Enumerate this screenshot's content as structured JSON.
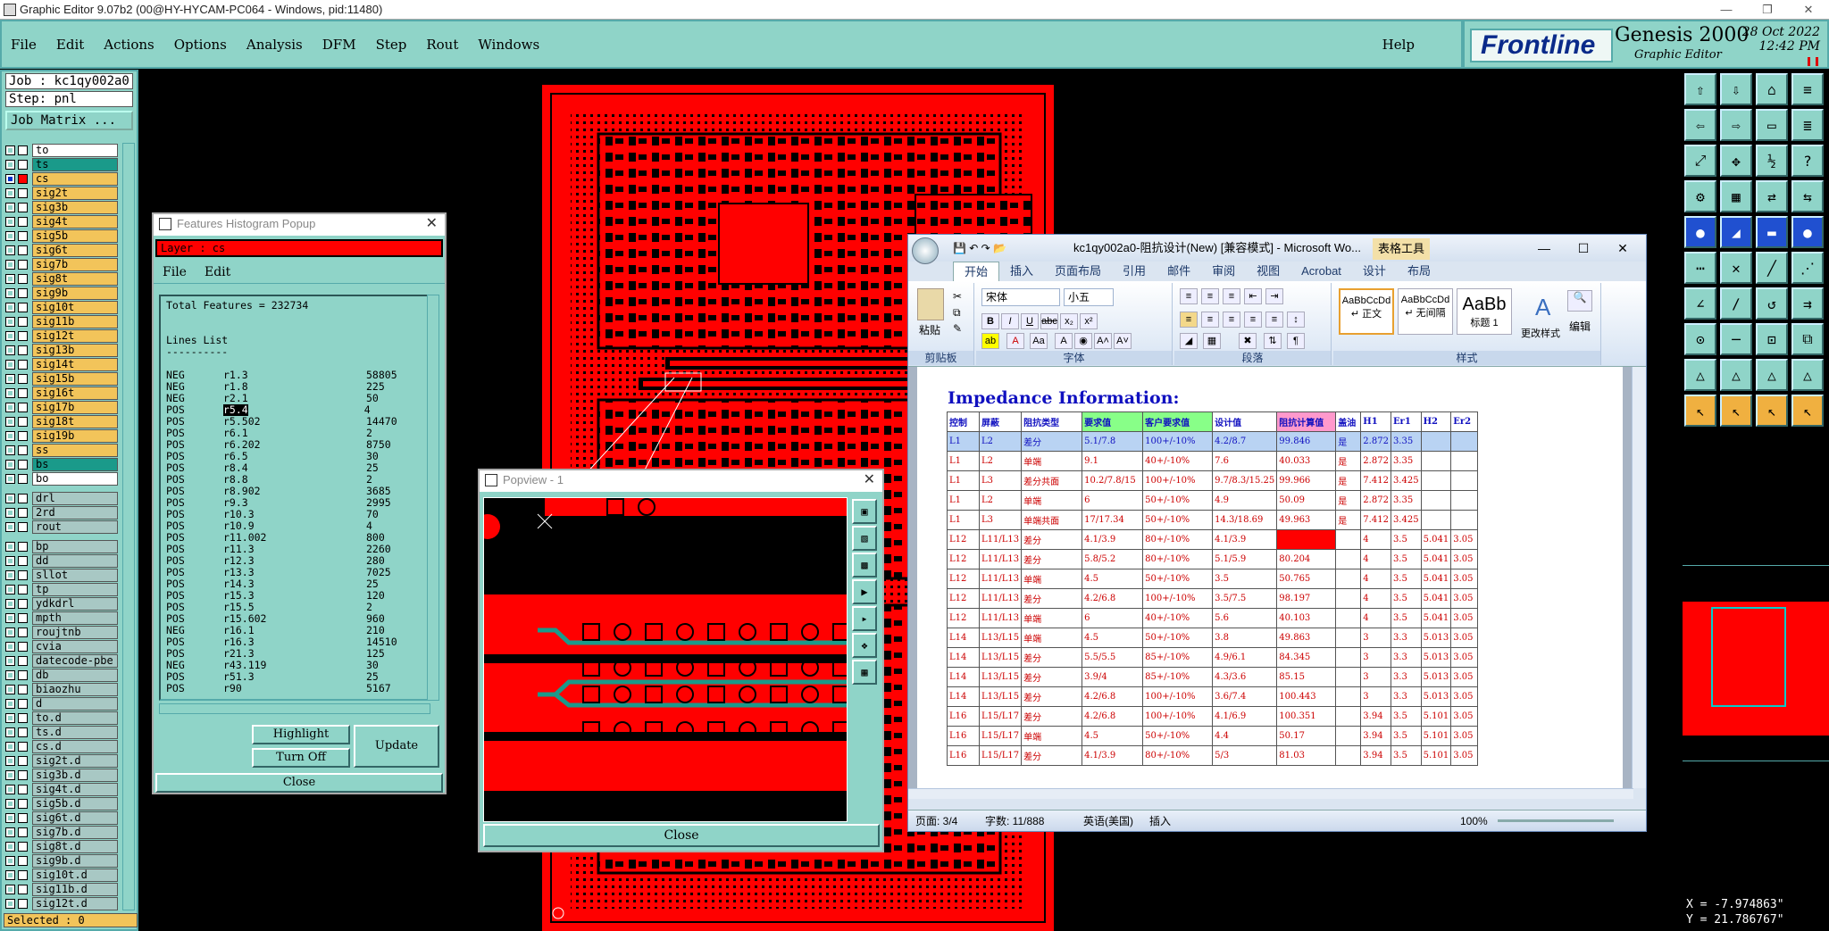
{
  "window": {
    "title": "Graphic Editor 9.07b2 (00@HY-HYCAM-PC064 - Windows, pid:11480)"
  },
  "menu": {
    "items": [
      "File",
      "Edit",
      "Actions",
      "Options",
      "Analysis",
      "DFM",
      "Step",
      "Rout",
      "Windows"
    ],
    "help": "Help"
  },
  "brand": {
    "logo": "Frontline",
    "product": "Genesis 2000",
    "editor": "Graphic Editor",
    "date": "28 Oct 2022",
    "time": "12:42 PM"
  },
  "left": {
    "job": "Job : kc1qy002a0",
    "step": "Step: pnl",
    "job_matrix": "Job Matrix ...",
    "selected": "Selected : 0",
    "layers": [
      {
        "name": "to",
        "color": "#ffffff"
      },
      {
        "name": "ts",
        "color": "#1a9a8a"
      },
      {
        "name": "cs",
        "color": "#f2c45a",
        "active": true
      },
      {
        "name": "sig2t",
        "color": "#f2c45a"
      },
      {
        "name": "sig3b",
        "color": "#f2c45a"
      },
      {
        "name": "sig4t",
        "color": "#f2c45a"
      },
      {
        "name": "sig5b",
        "color": "#f2c45a"
      },
      {
        "name": "sig6t",
        "color": "#f2c45a"
      },
      {
        "name": "sig7b",
        "color": "#f2c45a"
      },
      {
        "name": "sig8t",
        "color": "#f2c45a"
      },
      {
        "name": "sig9b",
        "color": "#f2c45a"
      },
      {
        "name": "sig10t",
        "color": "#f2c45a"
      },
      {
        "name": "sig11b",
        "color": "#f2c45a"
      },
      {
        "name": "sig12t",
        "color": "#f2c45a"
      },
      {
        "name": "sig13b",
        "color": "#f2c45a"
      },
      {
        "name": "sig14t",
        "color": "#f2c45a"
      },
      {
        "name": "sig15b",
        "color": "#f2c45a"
      },
      {
        "name": "sig16t",
        "color": "#f2c45a"
      },
      {
        "name": "sig17b",
        "color": "#f2c45a"
      },
      {
        "name": "sig18t",
        "color": "#f2c45a"
      },
      {
        "name": "sig19b",
        "color": "#f2c45a"
      },
      {
        "name": "ss",
        "color": "#f2c45a"
      },
      {
        "name": "bs",
        "color": "#1a9a8a"
      },
      {
        "name": "bo",
        "color": "#ffffff"
      },
      {
        "name": "drl",
        "color": "#a8c8c4",
        "gap": true
      },
      {
        "name": "2rd",
        "color": "#a8c8c4"
      },
      {
        "name": "rout",
        "color": "#a8c8c4"
      },
      {
        "name": "bp",
        "color": "#a8c8c4",
        "gap": true
      },
      {
        "name": "dd",
        "color": "#a8c8c4"
      },
      {
        "name": "sllot",
        "color": "#a8c8c4"
      },
      {
        "name": "tp",
        "color": "#a8c8c4"
      },
      {
        "name": "ydkdrl",
        "color": "#a8c8c4"
      },
      {
        "name": "mpth",
        "color": "#a8c8c4"
      },
      {
        "name": "roujtnb",
        "color": "#a8c8c4"
      },
      {
        "name": "cvia",
        "color": "#a8c8c4"
      },
      {
        "name": "datecode-pbe",
        "color": "#a8c8c4"
      },
      {
        "name": "db",
        "color": "#a8c8c4"
      },
      {
        "name": "biaozhu",
        "color": "#a8c8c4"
      },
      {
        "name": "d",
        "color": "#a8c8c4"
      },
      {
        "name": "to.d",
        "color": "#a8c8c4"
      },
      {
        "name": "ts.d",
        "color": "#a8c8c4"
      },
      {
        "name": "cs.d",
        "color": "#a8c8c4"
      },
      {
        "name": "sig2t.d",
        "color": "#a8c8c4"
      },
      {
        "name": "sig3b.d",
        "color": "#a8c8c4"
      },
      {
        "name": "sig4t.d",
        "color": "#a8c8c4"
      },
      {
        "name": "sig5b.d",
        "color": "#a8c8c4"
      },
      {
        "name": "sig6t.d",
        "color": "#a8c8c4"
      },
      {
        "name": "sig7b.d",
        "color": "#a8c8c4"
      },
      {
        "name": "sig8t.d",
        "color": "#a8c8c4"
      },
      {
        "name": "sig9b.d",
        "color": "#a8c8c4"
      },
      {
        "name": "sig10t.d",
        "color": "#a8c8c4"
      },
      {
        "name": "sig11b.d",
        "color": "#a8c8c4"
      },
      {
        "name": "sig12t.d",
        "color": "#a8c8c4"
      }
    ]
  },
  "histogram": {
    "title": "Features Histogram Popup",
    "layer": "Layer :  cs",
    "menu": [
      "File",
      "Edit"
    ],
    "total": "Total Features = 232734",
    "section": "Lines List",
    "divider": "----------",
    "rows": [
      [
        "NEG",
        "r1.3",
        "58805"
      ],
      [
        "NEG",
        "r1.8",
        "225"
      ],
      [
        "NEG",
        "r2.1",
        "50"
      ],
      [
        "POS",
        "r5.4",
        "4"
      ],
      [
        "POS",
        "r5.502",
        "14470"
      ],
      [
        "POS",
        "r6.1",
        "2"
      ],
      [
        "POS",
        "r6.202",
        "8750"
      ],
      [
        "POS",
        "r6.5",
        "30"
      ],
      [
        "POS",
        "r8.4",
        "25"
      ],
      [
        "POS",
        "r8.8",
        "2"
      ],
      [
        "POS",
        "r8.902",
        "3685"
      ],
      [
        "POS",
        "r9.3",
        "2995"
      ],
      [
        "POS",
        "r10.3",
        "70"
      ],
      [
        "POS",
        "r10.9",
        "4"
      ],
      [
        "POS",
        "r11.002",
        "800"
      ],
      [
        "POS",
        "r11.3",
        "2260"
      ],
      [
        "POS",
        "r12.3",
        "280"
      ],
      [
        "POS",
        "r13.3",
        "7025"
      ],
      [
        "POS",
        "r14.3",
        "25"
      ],
      [
        "POS",
        "r15.3",
        "120"
      ],
      [
        "POS",
        "r15.5",
        "2"
      ],
      [
        "POS",
        "r15.602",
        "960"
      ],
      [
        "NEG",
        "r16.1",
        "210"
      ],
      [
        "POS",
        "r16.3",
        "14510"
      ],
      [
        "POS",
        "r21.3",
        "125"
      ],
      [
        "NEG",
        "r43.119",
        "30"
      ],
      [
        "POS",
        "r51.3",
        "25"
      ],
      [
        "POS",
        "r90",
        "5167"
      ]
    ],
    "highlight": "Highlight",
    "turn_off": "Turn Off",
    "update": "Update",
    "close": "Close"
  },
  "popview": {
    "title": "Popview - 1",
    "close": "Close"
  },
  "word": {
    "title": "kc1qy002a0-阻抗设计(New) [兼容模式] - Microsoft Wo...",
    "tools": "表格工具",
    "tabs": [
      "开始",
      "插入",
      "页面布局",
      "引用",
      "邮件",
      "审阅",
      "视图",
      "Acrobat",
      "设计",
      "布局"
    ],
    "font": "宋体",
    "size": "小五",
    "groups": [
      "剪贴板",
      "字体",
      "段落",
      "样式"
    ],
    "paste": "粘贴",
    "styles": [
      {
        "sample": "AaBbCcDd",
        "name": "↵ 正文"
      },
      {
        "sample": "AaBbCcDd",
        "name": "↵ 无间隔"
      },
      {
        "sample": "AaBb",
        "name": "标题 1"
      }
    ],
    "more_styles": "更改样式",
    "edit": "编辑",
    "doc_title": "Impedance Information:",
    "headers": [
      "控制",
      "屏蔽",
      "阻抗类型",
      "要求值",
      "客户要求值",
      "设计值",
      "阻抗计算值",
      "盖油",
      "H1",
      "Er1",
      "H2",
      "Er2"
    ],
    "rows": [
      [
        "L1",
        "L2",
        "差分",
        "5.1/7.8",
        "100+/-10%",
        "4.2/8.7",
        "99.846",
        "是",
        "2.872",
        "3.35",
        "",
        ""
      ],
      [
        "L1",
        "L2",
        "单端",
        "9.1",
        "40+/-10%",
        "7.6",
        "40.033",
        "是",
        "2.872",
        "3.35",
        "",
        ""
      ],
      [
        "L1",
        "L3",
        "差分共面",
        "10.2/7.8/15",
        "100+/-10%",
        "9.7/8.3/15.25",
        "99.966",
        "是",
        "7.412",
        "3.425",
        "",
        ""
      ],
      [
        "L1",
        "L2",
        "单端",
        "6",
        "50+/-10%",
        "4.9",
        "50.09",
        "是",
        "2.872",
        "3.35",
        "",
        ""
      ],
      [
        "L1",
        "L3",
        "单端共面",
        "17/17.34",
        "50+/-10%",
        "14.3/18.69",
        "49.963",
        "是",
        "7.412",
        "3.425",
        "",
        ""
      ],
      [
        "L12",
        "L11/L13",
        "差分",
        "4.1/3.9",
        "80+/-10%",
        "4.1/3.9",
        "",
        "",
        "4",
        "3.5",
        "5.041",
        "3.05"
      ],
      [
        "L12",
        "L11/L13",
        "差分",
        "5.8/5.2",
        "80+/-10%",
        "5.1/5.9",
        "80.204",
        "",
        "4",
        "3.5",
        "5.041",
        "3.05"
      ],
      [
        "L12",
        "L11/L13",
        "单端",
        "4.5",
        "50+/-10%",
        "3.5",
        "50.765",
        "",
        "4",
        "3.5",
        "5.041",
        "3.05"
      ],
      [
        "L12",
        "L11/L13",
        "差分",
        "4.2/6.8",
        "100+/-10%",
        "3.5/7.5",
        "98.197",
        "",
        "4",
        "3.5",
        "5.041",
        "3.05"
      ],
      [
        "L12",
        "L11/L13",
        "单端",
        "6",
        "40+/-10%",
        "5.6",
        "40.103",
        "",
        "4",
        "3.5",
        "5.041",
        "3.05"
      ],
      [
        "L14",
        "L13/L15",
        "单端",
        "4.5",
        "50+/-10%",
        "3.8",
        "49.863",
        "",
        "3",
        "3.3",
        "5.013",
        "3.05"
      ],
      [
        "L14",
        "L13/L15",
        "差分",
        "5.5/5.5",
        "85+/-10%",
        "4.9/6.1",
        "84.345",
        "",
        "3",
        "3.3",
        "5.013",
        "3.05"
      ],
      [
        "L14",
        "L13/L15",
        "差分",
        "3.9/4",
        "85+/-10%",
        "4.3/3.6",
        "85.15",
        "",
        "3",
        "3.3",
        "5.013",
        "3.05"
      ],
      [
        "L14",
        "L13/L15",
        "差分",
        "4.2/6.8",
        "100+/-10%",
        "3.6/7.4",
        "100.443",
        "",
        "3",
        "3.3",
        "5.013",
        "3.05"
      ],
      [
        "L16",
        "L15/L17",
        "差分",
        "4.2/6.8",
        "100+/-10%",
        "4.1/6.9",
        "100.351",
        "",
        "3.94",
        "3.5",
        "5.101",
        "3.05"
      ],
      [
        "L16",
        "L15/L17",
        "单端",
        "4.5",
        "50+/-10%",
        "4.4",
        "50.17",
        "",
        "3.94",
        "3.5",
        "5.101",
        "3.05"
      ],
      [
        "L16",
        "L15/L17",
        "差分",
        "4.1/3.9",
        "80+/-10%",
        "5/3",
        "81.03",
        "",
        "3.94",
        "3.5",
        "5.101",
        "3.05"
      ]
    ],
    "status": {
      "page": "页面: 3/4",
      "words": "字数: 11/888",
      "lang": "英语(美国)",
      "mode": "插入",
      "zoom": "100%"
    }
  },
  "coords": {
    "x": "X = -7.974863\"",
    "y": "Y = 21.786767\""
  },
  "colors": {
    "panel": "#8fd4c8",
    "copper": "#ff0000",
    "accent_orange": "#f2c45a"
  }
}
